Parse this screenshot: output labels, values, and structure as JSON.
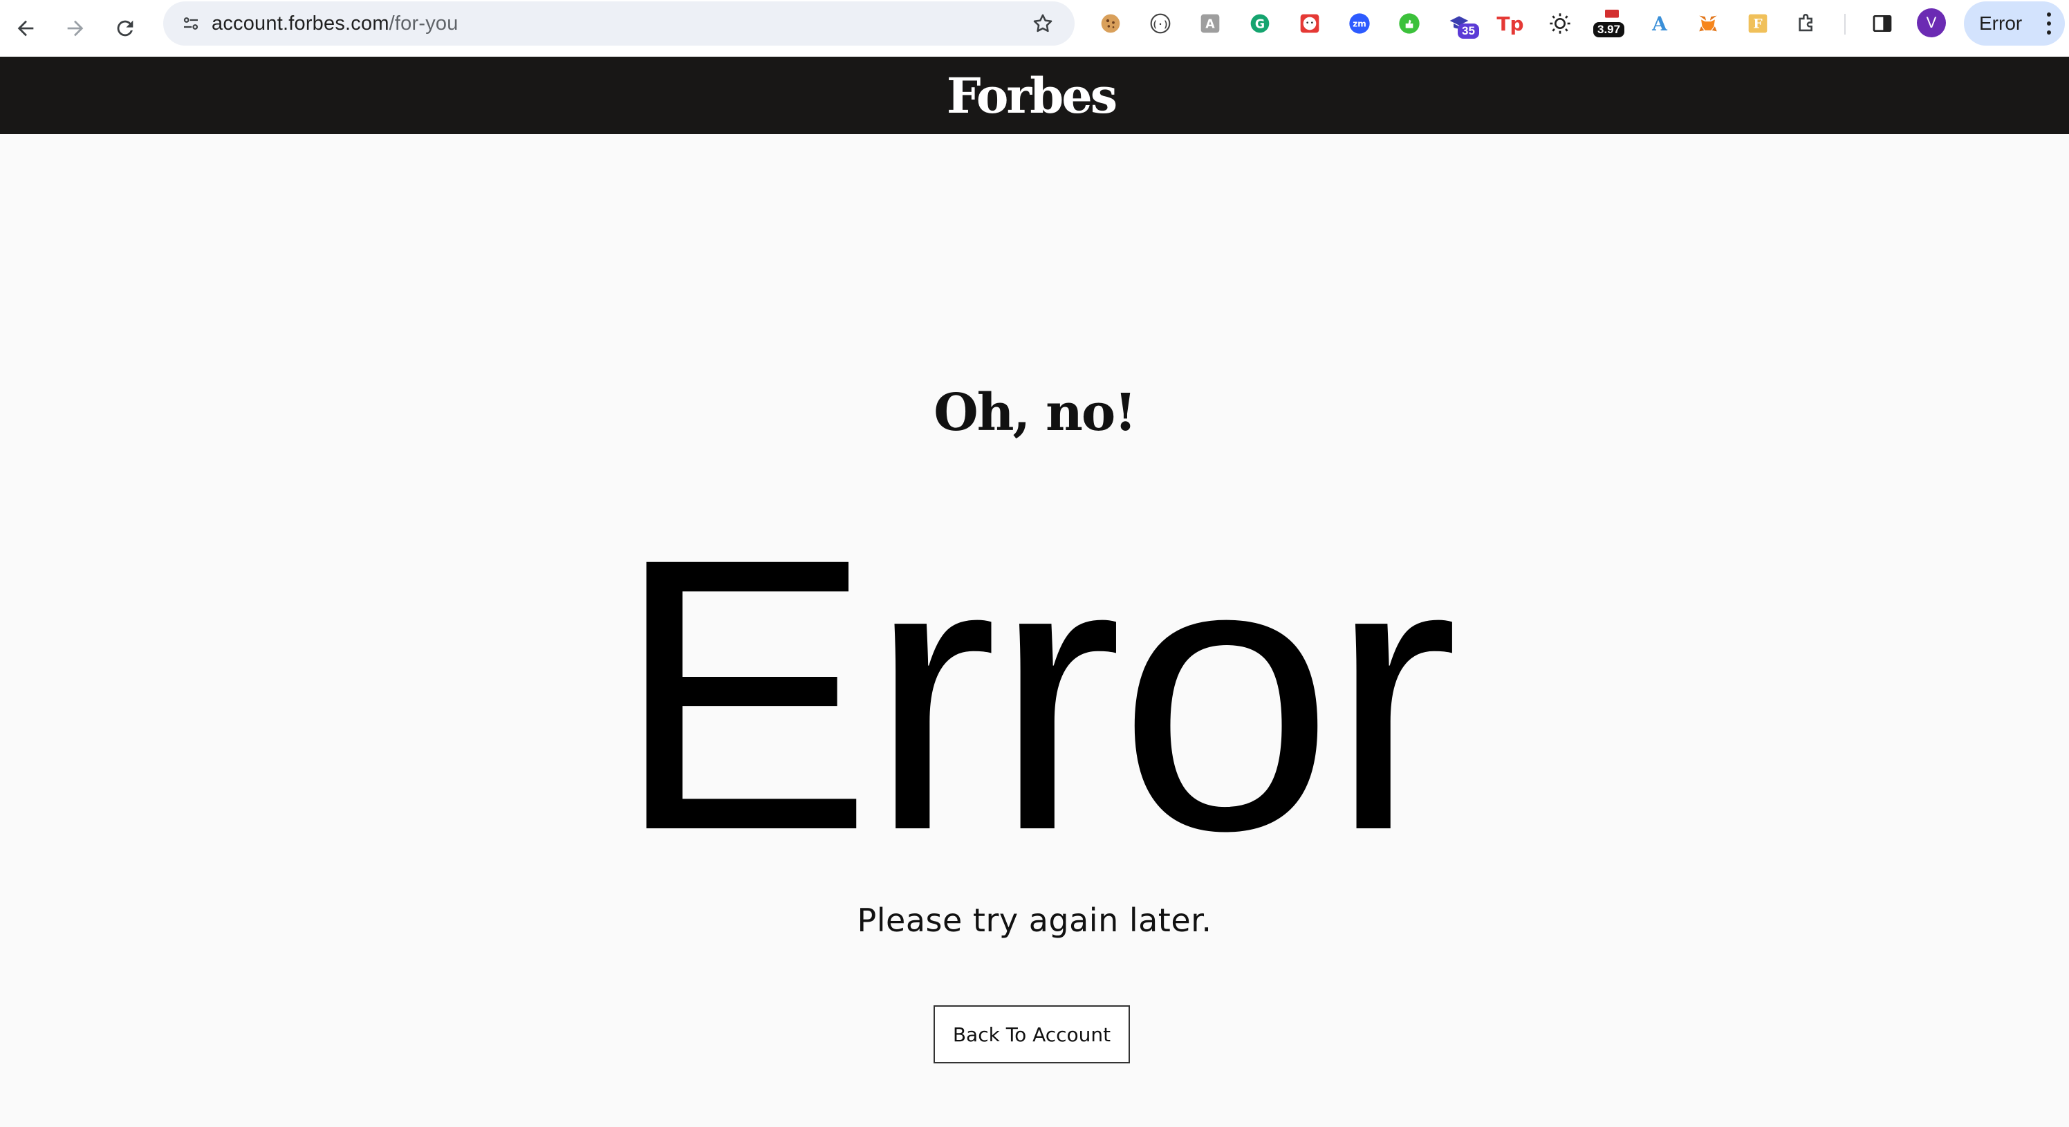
{
  "browser": {
    "url_domain": "account.forbes.com",
    "url_path": "/for-you",
    "extensions": [
      {
        "name": "cookie-extension-icon"
      },
      {
        "name": "code-brackets-extension-icon"
      },
      {
        "name": "translate-extension-icon"
      },
      {
        "name": "grammarly-extension-icon"
      },
      {
        "name": "face-extension-icon"
      },
      {
        "name": "zoom-extension-icon"
      },
      {
        "name": "green-thumb-extension-icon"
      },
      {
        "name": "graduation-cap-extension-icon",
        "badge": "35"
      },
      {
        "name": "tp-extension-icon"
      },
      {
        "name": "sun-extension-icon"
      },
      {
        "name": "lcp-extension-icon",
        "badge": "3.97"
      },
      {
        "name": "a-letter-extension-icon"
      },
      {
        "name": "metamask-extension-icon"
      },
      {
        "name": "f-letter-extension-icon"
      },
      {
        "name": "puzzle-extensions-icon"
      }
    ],
    "profile_initial": "V",
    "tab_chip_label": "Error"
  },
  "site": {
    "logo": "Forbes"
  },
  "page": {
    "heading": "Oh, no!",
    "error_title": "Error",
    "message": "Please try again later.",
    "back_button": "Back To Account"
  },
  "colors": {
    "header_bg": "#181716",
    "page_bg": "#fafafa",
    "avatar_bg": "#6b2bb3",
    "chip_bg": "#d3e3fd"
  }
}
